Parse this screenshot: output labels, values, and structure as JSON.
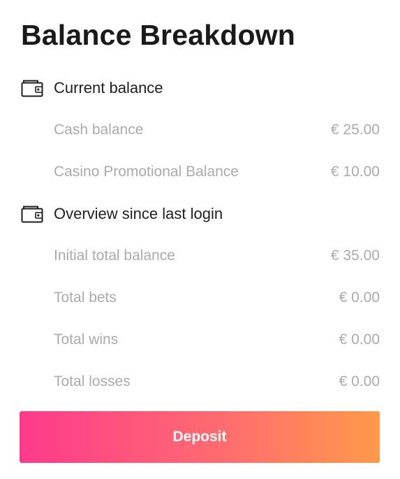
{
  "title": "Balance Breakdown",
  "sections": [
    {
      "icon": "wallet-icon",
      "label": "Current balance",
      "rows": [
        {
          "name": "Cash balance",
          "amount": "€ 25.00"
        },
        {
          "name": "Casino Promotional Balance",
          "amount": "€ 10.00"
        }
      ]
    },
    {
      "icon": "wallet-icon",
      "label": "Overview since last login",
      "rows": [
        {
          "name": "Initial total balance",
          "amount": "€ 35.00"
        },
        {
          "name": "Total bets",
          "amount": "€ 0.00"
        },
        {
          "name": "Total wins",
          "amount": "€ 0.00"
        },
        {
          "name": "Total losses",
          "amount": "€ 0.00"
        }
      ]
    }
  ],
  "deposit_label": "Deposit",
  "colors": {
    "deposit_gradient_start": "#ff3a8c",
    "deposit_gradient_end": "#ff9a4a",
    "muted_text": "#ababab"
  }
}
